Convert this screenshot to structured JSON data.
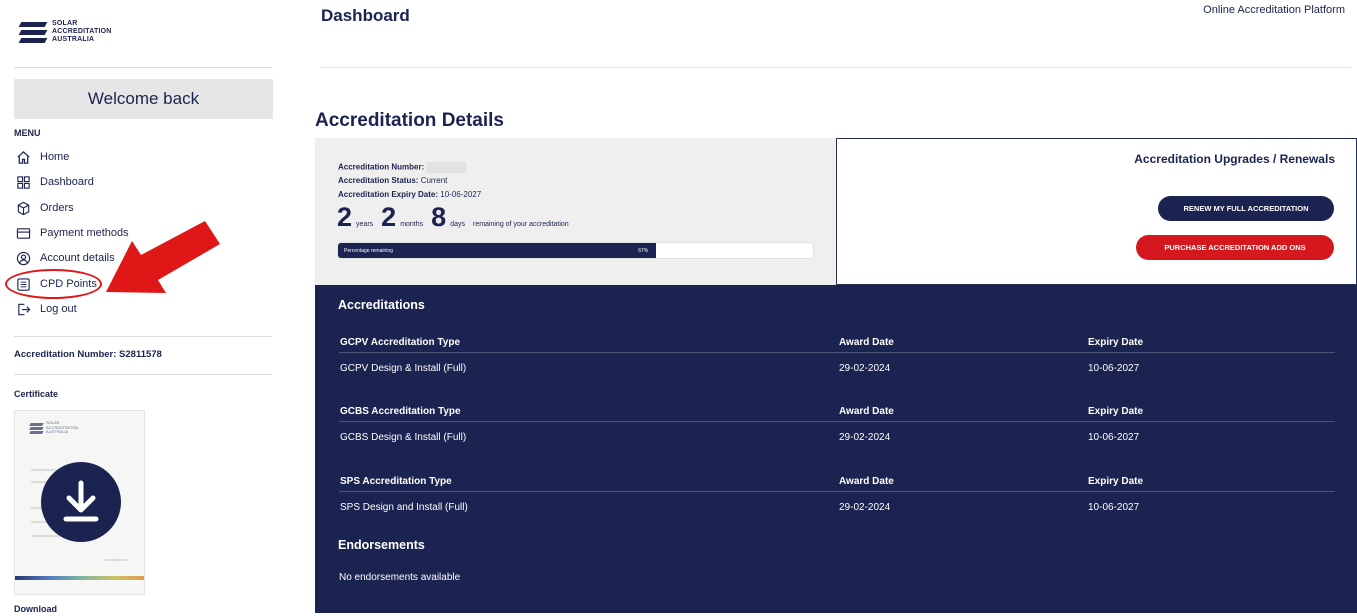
{
  "sidebar": {
    "logo_lines": [
      "SOLAR",
      "ACCREDITATION",
      "AUSTRALIA"
    ],
    "welcome": "Welcome back",
    "menu_label": "MENU",
    "menu": [
      {
        "label": "Home",
        "icon": "home-icon"
      },
      {
        "label": "Dashboard",
        "icon": "dashboard-grid-icon"
      },
      {
        "label": "Orders",
        "icon": "orders-box-icon"
      },
      {
        "label": "Payment methods",
        "icon": "credit-card-icon"
      },
      {
        "label": "Account details",
        "icon": "user-circle-icon"
      },
      {
        "label": "CPD Points",
        "icon": "list-document-icon"
      },
      {
        "label": "Log out",
        "icon": "logout-icon"
      }
    ],
    "accreditation_number": "Accreditation Number: S2811578",
    "certificate_label": "Certificate",
    "download_label": "Download"
  },
  "header": {
    "title": "Dashboard",
    "platform": "Online Accreditation Platform"
  },
  "details": {
    "section_title": "Accreditation Details",
    "number_label": "Accreditation Number:",
    "status_label": "Accreditation Status:",
    "status_value": "Current",
    "expiry_label": "Accreditation Expiry Date:",
    "expiry_value": "10-06-2027",
    "years": "2",
    "years_unit": "years",
    "months": "2",
    "months_unit": "months",
    "days": "8",
    "days_unit": "days",
    "remaining_text": "remaining of your accreditation",
    "progress_label": "Percentage remaining",
    "progress_value": "67%",
    "progress_fraction": 0.67
  },
  "upgrades": {
    "title": "Accreditation Upgrades / Renewals",
    "renew_button": "RENEW MY FULL ACCREDITATION",
    "purchase_button": "PURCHASE ACCREDITATION ADD ONS"
  },
  "accreditations": {
    "title": "Accreditations",
    "award_header": "Award Date",
    "expiry_header": "Expiry Date",
    "rows": [
      {
        "type_header": "GCPV Accreditation Type",
        "name": "GCPV Design & Install (Full)",
        "award": "29-02-2024",
        "expiry": "10-06-2027"
      },
      {
        "type_header": "GCBS Accreditation Type",
        "name": "GCBS Design & Install (Full)",
        "award": "29-02-2024",
        "expiry": "10-06-2027"
      },
      {
        "type_header": "SPS Accreditation Type",
        "name": "SPS Design and Install (Full)",
        "award": "29-02-2024",
        "expiry": "10-06-2027"
      }
    ],
    "endorsements_title": "Endorsements",
    "endorsements_text": "No endorsements available"
  },
  "colors": {
    "navy": "#1b2350",
    "red": "#d5181e",
    "annotation_red": "#e01717"
  }
}
